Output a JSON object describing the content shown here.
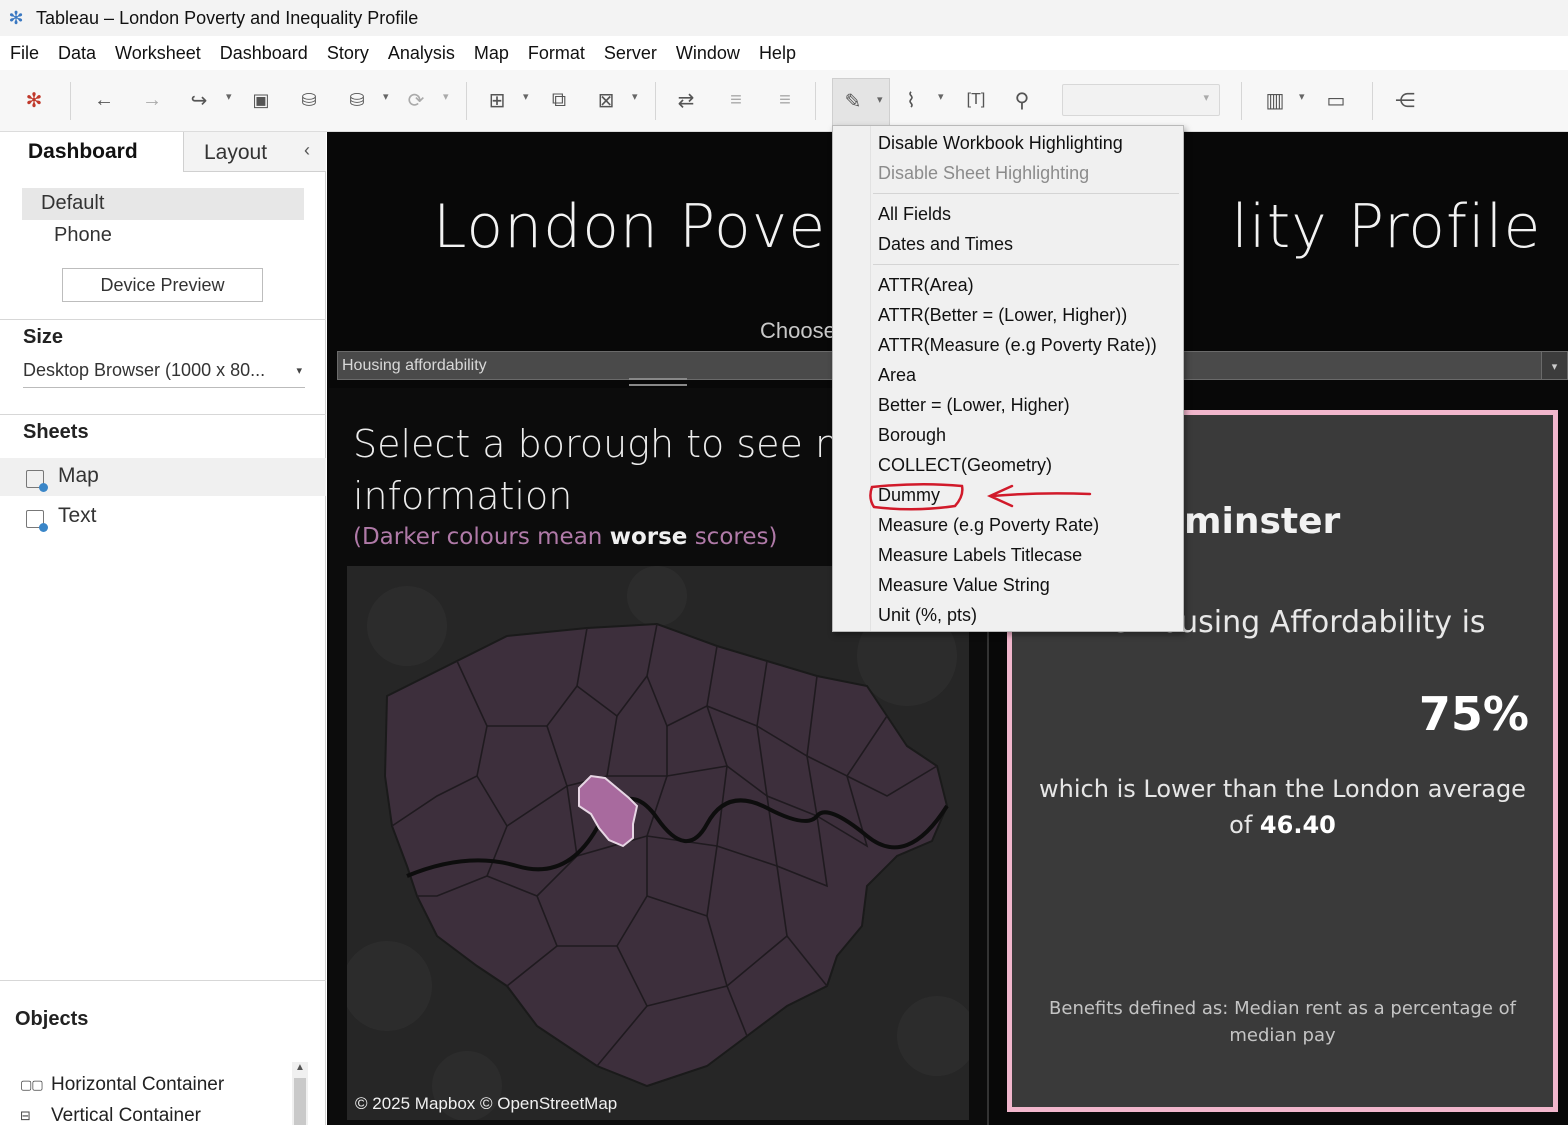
{
  "window": {
    "title": "Tableau – London Poverty and Inequality Profile",
    "app_icon": "tableau-logo-icon"
  },
  "menu": [
    "File",
    "Data",
    "Worksheet",
    "Dashboard",
    "Story",
    "Analysis",
    "Map",
    "Format",
    "Server",
    "Window",
    "Help"
  ],
  "toolbar": {
    "icons": [
      "tableau-logo-icon",
      "undo-icon",
      "redo-icon",
      "replay-icon",
      "save-icon",
      "new-datasource-icon",
      "pause-updates-icon",
      "refresh-icon",
      "new-worksheet-icon",
      "duplicate-sheet-icon",
      "clear-sheet-icon",
      "swap-icon",
      "sort-ascending-icon",
      "sort-descending-icon",
      "highlight-icon",
      "group-icon",
      "labels-icon",
      "pin-icon",
      "show-me-icon",
      "presentation-icon",
      "share-icon"
    ],
    "fit_dropdown_value": ""
  },
  "left_panel": {
    "tabs": {
      "dashboard": "Dashboard",
      "layout": "Layout"
    },
    "devices": {
      "default": "Default",
      "phone": "Phone"
    },
    "device_preview": "Device Preview",
    "size": {
      "heading": "Size",
      "value": "Desktop Browser (1000 x 80..."
    },
    "sheets": {
      "heading": "Sheets",
      "items": [
        "Map",
        "Text"
      ]
    },
    "objects": {
      "heading": "Objects",
      "items": [
        "Horizontal Container",
        "Vertical Container"
      ]
    }
  },
  "dashboard": {
    "title_left": "London Povert",
    "title_right": "lity Profile",
    "choose_label": "Choose",
    "parameter_value": "Housing affordability",
    "select_heading": "Select a borough to see mor information",
    "hint_prefix": "(Darker colours mean ",
    "hint_bold": "worse",
    "hint_suffix": " scores)",
    "map_credit": "© 2025 Mapbox © OpenStreetMap",
    "info": {
      "borough_partial": "minster",
      "measure_sentence": "the Housing Affordability is",
      "value": "75%",
      "compare_text": "which is Lower than the London average of ",
      "london_average": "46.40",
      "definition": "Benefits defined as: Median rent as a percentage of median pay"
    },
    "colors": {
      "border": "#f1b6cc",
      "selected_borough": "#a86a9e",
      "borough_fill": "#3d2f3c"
    }
  },
  "highlight_menu": {
    "items": [
      {
        "label": "Disable Workbook Highlighting",
        "disabled": false
      },
      {
        "label": "Disable Sheet Highlighting",
        "disabled": true
      },
      {
        "label": "All Fields",
        "disabled": false
      },
      {
        "label": "Dates and Times",
        "disabled": false
      },
      {
        "label": "ATTR(Area)",
        "disabled": false
      },
      {
        "label": "ATTR(Better = (Lower, Higher))",
        "disabled": false
      },
      {
        "label": "ATTR(Measure (e.g Poverty Rate))",
        "disabled": false
      },
      {
        "label": "Area",
        "disabled": false
      },
      {
        "label": "Better = (Lower, Higher)",
        "disabled": false
      },
      {
        "label": "Borough",
        "disabled": false
      },
      {
        "label": "COLLECT(Geometry)",
        "disabled": false
      },
      {
        "label": "Dummy",
        "disabled": false,
        "annotated": true
      },
      {
        "label": "Measure (e.g Poverty Rate)",
        "disabled": false
      },
      {
        "label": "Measure Labels Titlecase",
        "disabled": false
      },
      {
        "label": "Measure Value String",
        "disabled": false
      },
      {
        "label": "Unit (%, pts)",
        "disabled": false
      }
    ],
    "annotation_color": "#d11a2a"
  }
}
